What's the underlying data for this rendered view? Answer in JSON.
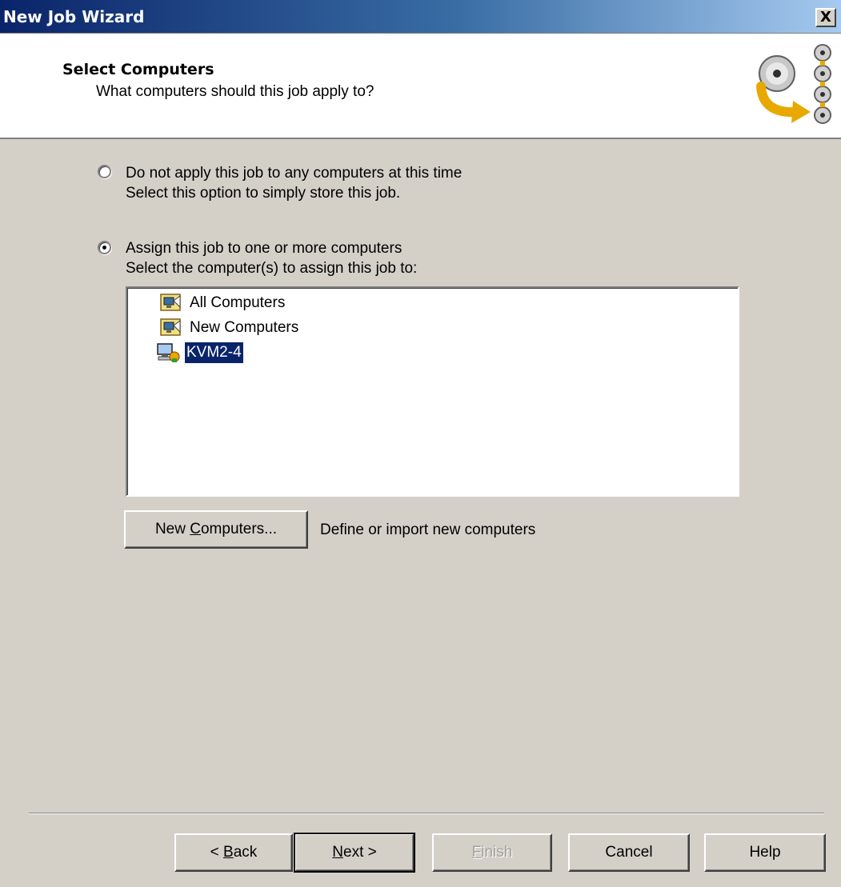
{
  "window": {
    "title": "New Job Wizard",
    "close_label": "X"
  },
  "header": {
    "title": "Select Computers",
    "subtitle": "What computers should this job apply to?",
    "icon": "wizard-disc-arrow-icon"
  },
  "options": [
    {
      "label": "Do not apply this job to any computers at this time",
      "description": "Select this option to simply store this job.",
      "checked": false
    },
    {
      "label": "Assign this job to one or more computers",
      "description": "Select the computer(s) to assign this job to:",
      "checked": true
    }
  ],
  "computer_list": {
    "items": [
      {
        "label": "All Computers",
        "icon": "computer-group-icon",
        "selected": false
      },
      {
        "label": "New Computers",
        "icon": "computer-group-icon",
        "selected": false
      },
      {
        "label": "KVM2-4",
        "icon": "computer-icon",
        "selected": true
      }
    ]
  },
  "new_computers": {
    "button_pre": "New ",
    "button_mnemonic": "C",
    "button_post": "omputers...",
    "description": "Define or import new computers"
  },
  "footer": {
    "back": {
      "pre": "< ",
      "mnemonic": "B",
      "post": "ack"
    },
    "next": {
      "pre": "",
      "mnemonic": "N",
      "post": "ext >"
    },
    "finish": {
      "pre": "",
      "mnemonic": "F",
      "post": "inish"
    },
    "cancel": "Cancel",
    "help": "Help"
  }
}
